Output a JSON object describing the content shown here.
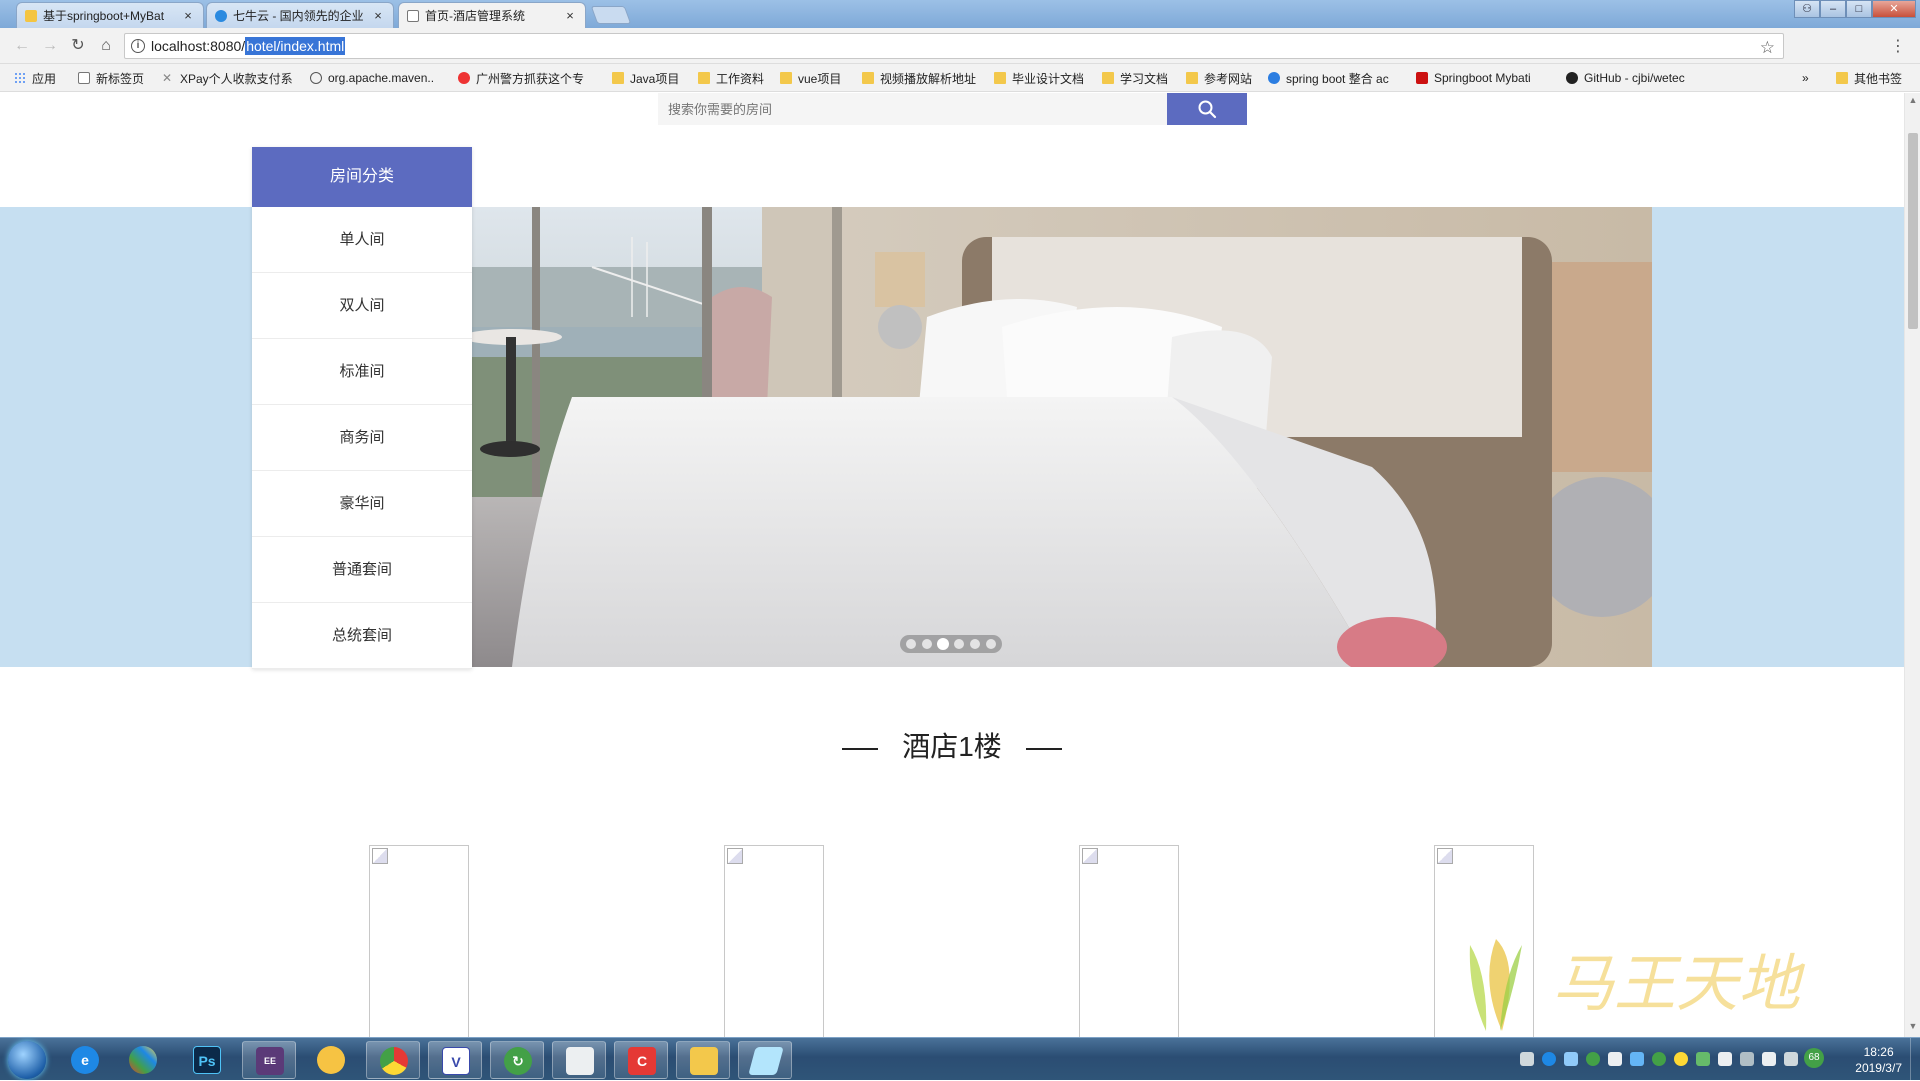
{
  "browser": {
    "tabs": [
      {
        "title": "基于springboot+MyBat",
        "active": false
      },
      {
        "title": "七牛云 - 国内领先的企业",
        "active": false
      },
      {
        "title": "首页-酒店管理系统",
        "active": true
      }
    ],
    "address": {
      "host": "localhost:8080/",
      "path": "hotel/index.html"
    },
    "bookmarks": [
      {
        "label": "应用",
        "icon": "apps-grid-icon"
      },
      {
        "label": "新标签页",
        "icon": "page-icon"
      },
      {
        "label": "XPay个人收款支付系",
        "icon": "x-icon"
      },
      {
        "label": "org.apache.maven..",
        "icon": "maven-icon"
      },
      {
        "label": "广州警方抓获这个专",
        "icon": "weibo-icon"
      },
      {
        "label": "Java项目",
        "icon": "folder-icon"
      },
      {
        "label": "工作资料",
        "icon": "folder-icon"
      },
      {
        "label": "vue项目",
        "icon": "folder-icon"
      },
      {
        "label": "视频播放解析地址",
        "icon": "folder-icon"
      },
      {
        "label": "毕业设计文档",
        "icon": "folder-icon"
      },
      {
        "label": "学习文档",
        "icon": "folder-icon"
      },
      {
        "label": "参考网站",
        "icon": "folder-icon"
      },
      {
        "label": "spring boot 整合 ac",
        "icon": "spring-icon"
      },
      {
        "label": "Springboot Mybati",
        "icon": "csdn-icon"
      },
      {
        "label": "GitHub - cjbi/wetec",
        "icon": "github-icon"
      }
    ],
    "bookmarks_overflow": "»",
    "other_bookmarks": "其他书签"
  },
  "page": {
    "search": {
      "placeholder": "搜索你需要的房间"
    },
    "categories": {
      "header": "房间分类",
      "items": [
        "单人间",
        "双人间",
        "标准间",
        "商务间",
        "豪华间",
        "普通套间",
        "总统套间"
      ]
    },
    "carousel": {
      "slide_count": 6,
      "active_index": 2
    },
    "floor": {
      "title": "酒店1楼"
    },
    "rooms": [
      {
        "image": "broken"
      },
      {
        "image": "broken"
      },
      {
        "image": "broken"
      },
      {
        "image": "broken"
      }
    ],
    "watermark": "马王天地"
  },
  "taskbar": {
    "apps": [
      "ie-icon",
      "app-icon",
      "photoshop-icon",
      "javaee-icon",
      "app-icon",
      "chrome-icon",
      "vmware-icon",
      "app-icon",
      "app-icon",
      "app-icon",
      "explorer-icon",
      "app-icon"
    ],
    "clock": {
      "time": "18:26",
      "date": "2019/3/7"
    },
    "tray_badge": "68"
  },
  "colors": {
    "accent": "#5c6bc0",
    "banner_bg": "#c6dff1"
  }
}
